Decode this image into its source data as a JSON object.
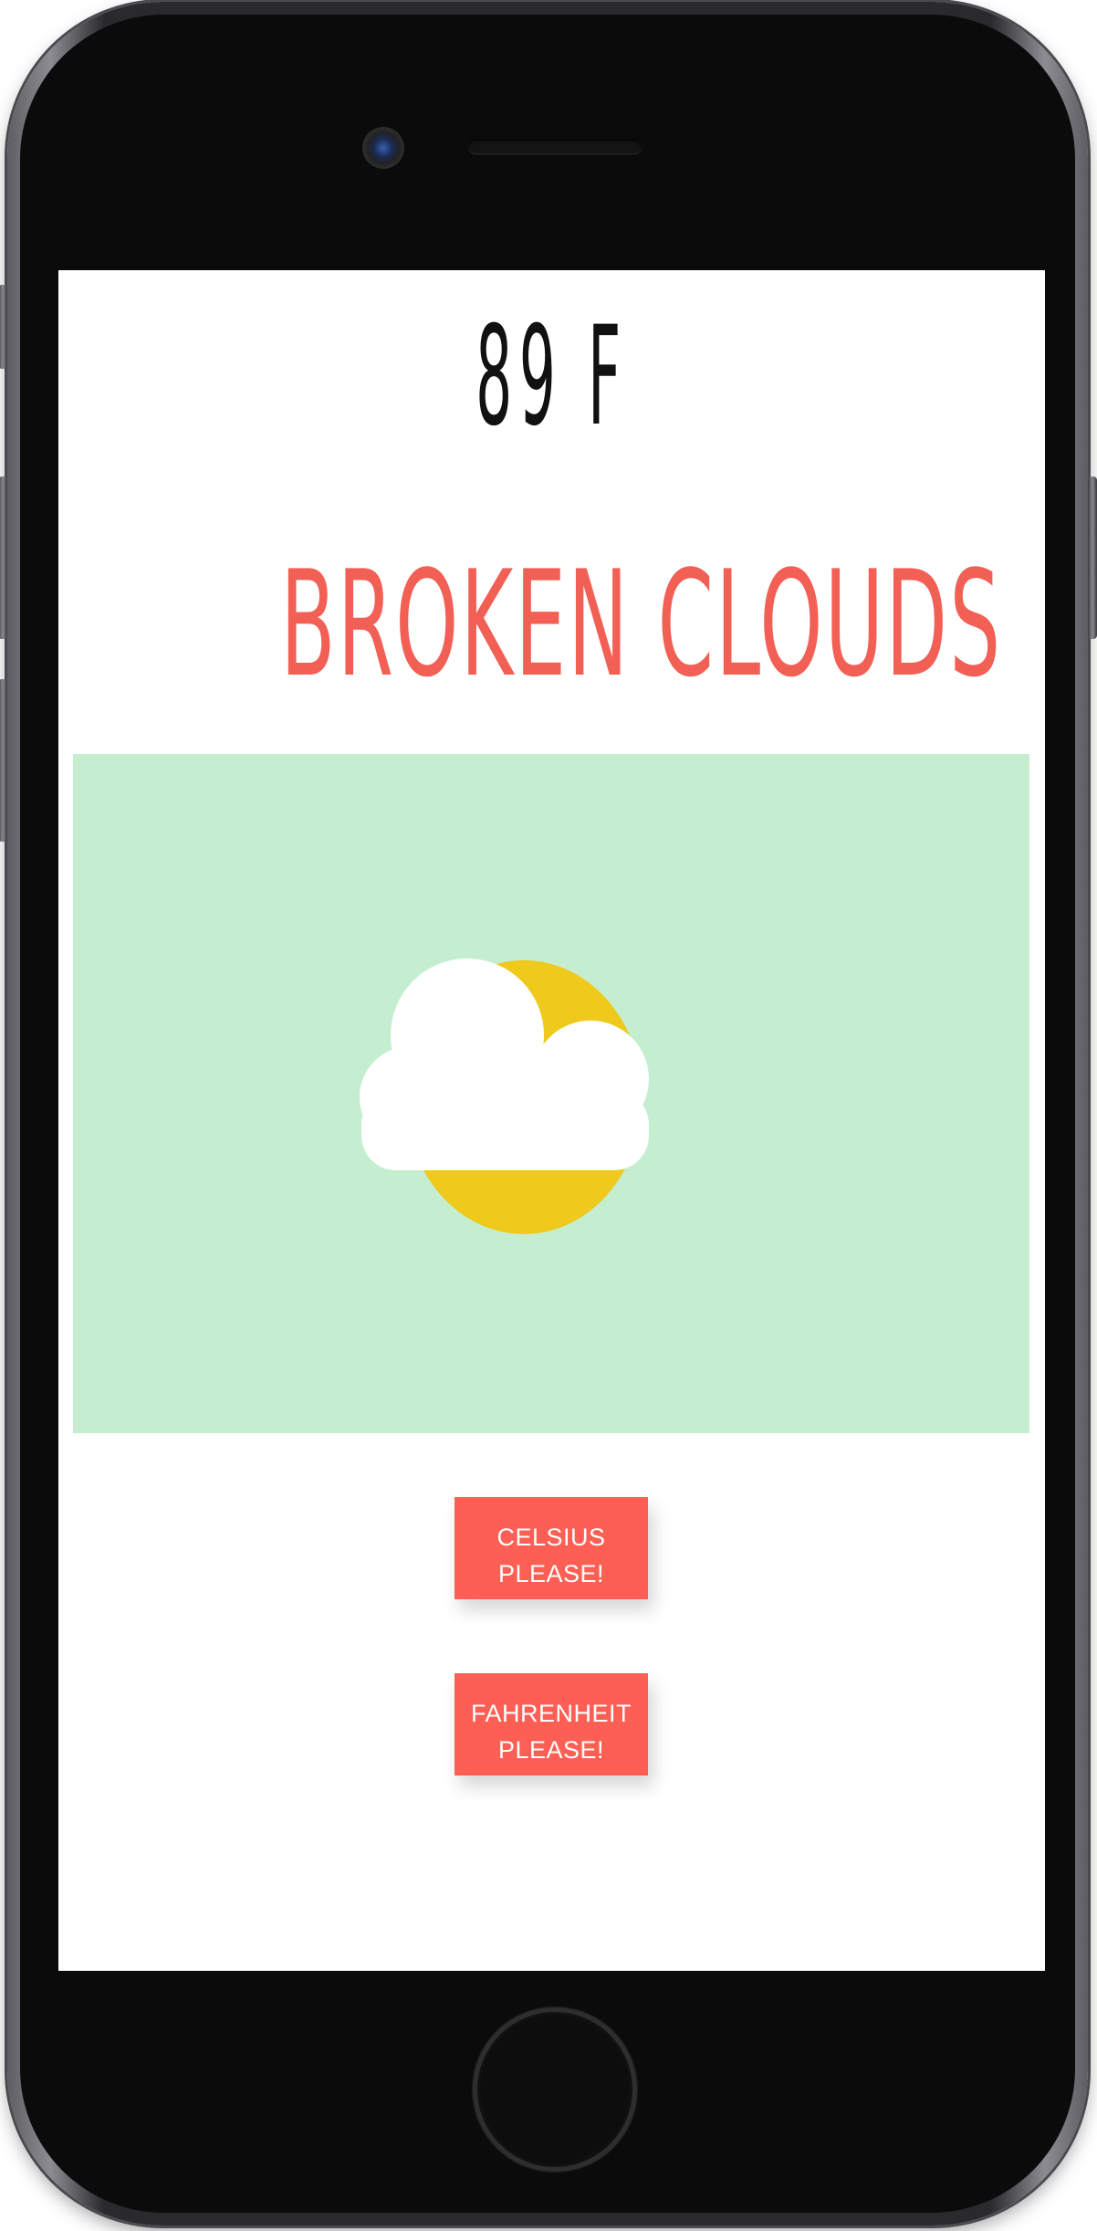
{
  "weather": {
    "temperature": "89 F",
    "description": "BROKEN CLOUDS",
    "icon": "broken-clouds-icon"
  },
  "buttons": {
    "celsius": {
      "line1": "CELSIUS",
      "line2": "PLEASE!"
    },
    "fahrenheit": {
      "line1": "FAHRENHEIT",
      "line2": "PLEASE!"
    }
  },
  "colors": {
    "accent": "#fd5f54",
    "description_text": "#f25f55",
    "panel_background": "#c5eed0",
    "sun": "#efc91b",
    "cloud": "#ffffff"
  }
}
